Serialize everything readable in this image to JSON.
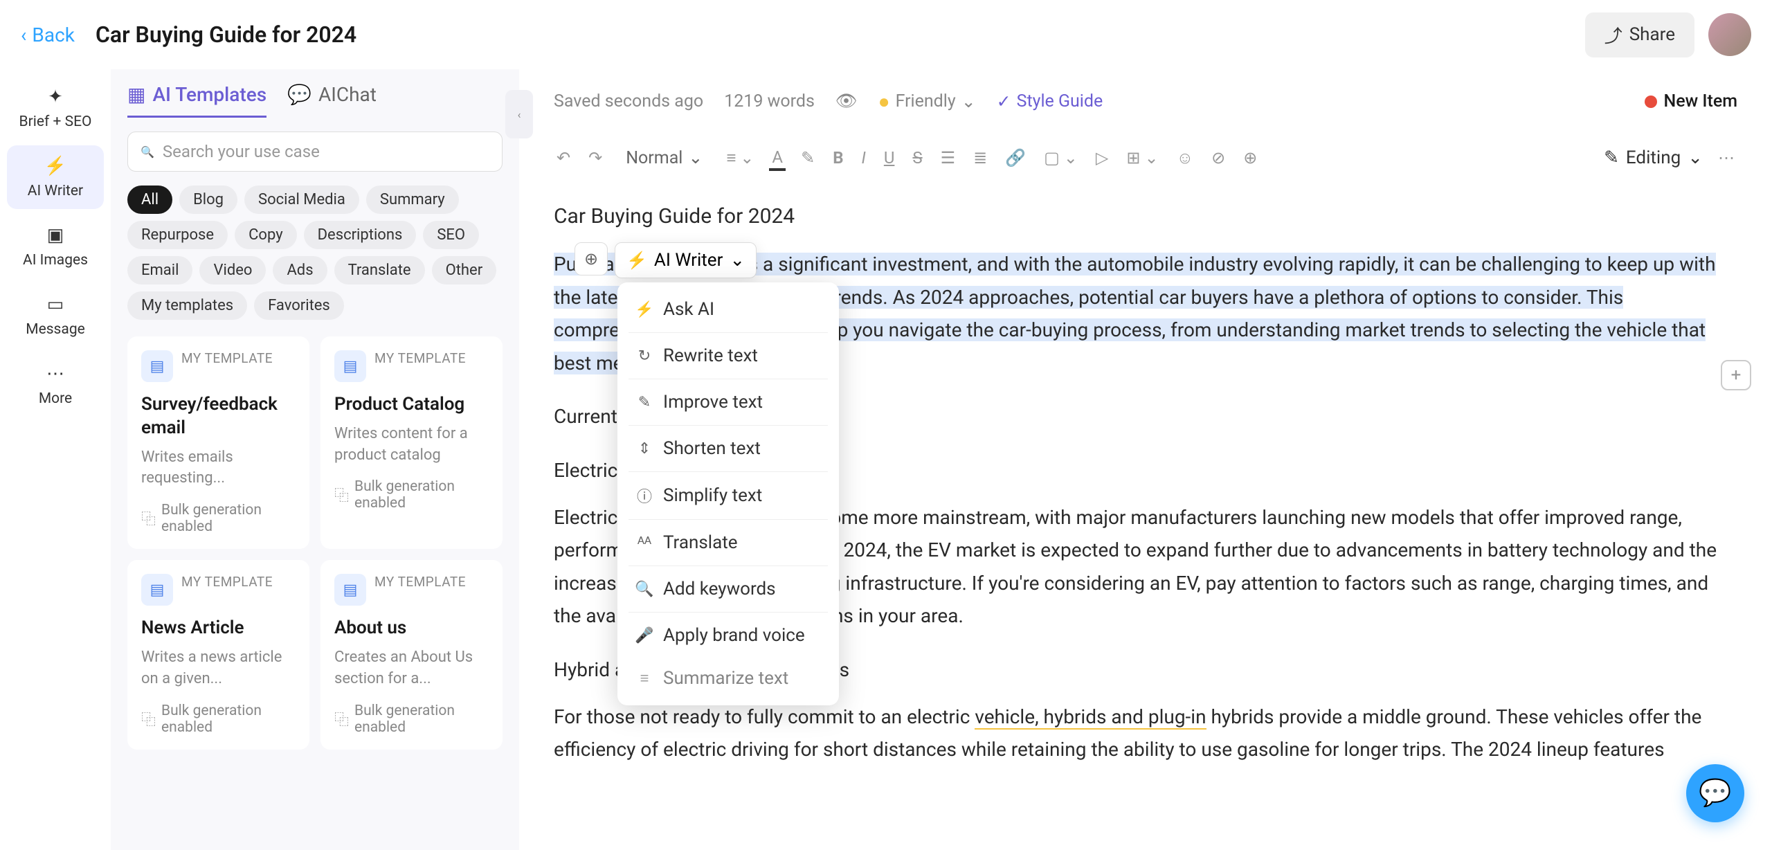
{
  "header": {
    "back_label": "Back",
    "title": "Car Buying Guide for 2024",
    "share_label": "Share"
  },
  "left_nav": {
    "items": [
      {
        "label": "Brief + SEO",
        "icon": "✦"
      },
      {
        "label": "AI Writer",
        "icon": "⚡"
      },
      {
        "label": "AI Images",
        "icon": "🖼"
      },
      {
        "label": "Message",
        "icon": "💬"
      },
      {
        "label": "More",
        "icon": "⋯"
      }
    ],
    "active_index": 1
  },
  "sidebar": {
    "tabs": [
      "AI Templates",
      "AIChat"
    ],
    "active_tab": 0,
    "search_placeholder": "Search your use case",
    "chips": [
      "All",
      "Blog",
      "Social Media",
      "Summary",
      "Repurpose",
      "Copy",
      "Descriptions",
      "SEO",
      "Email",
      "Video",
      "Ads",
      "Translate",
      "Other",
      "My templates",
      "Favorites"
    ],
    "active_chip": 0,
    "cards": [
      {
        "tag": "MY TEMPLATE",
        "title": "Survey/feedback email",
        "desc": "Writes emails requesting...",
        "footer": "Bulk generation enabled"
      },
      {
        "tag": "MY TEMPLATE",
        "title": "Product Catalog",
        "desc": "Writes content for a product catalog",
        "footer": "Bulk generation enabled"
      },
      {
        "tag": "MY TEMPLATE",
        "title": "News Article",
        "desc": "Writes a news article on a given...",
        "footer": "Bulk generation enabled"
      },
      {
        "tag": "MY TEMPLATE",
        "title": "About us",
        "desc": "Creates an About Us section for a...",
        "footer": "Bulk generation enabled"
      }
    ]
  },
  "editor_top": {
    "saved": "Saved seconds ago",
    "word_count": "1219 words",
    "tone": "Friendly",
    "style_guide": "Style Guide",
    "new_item": "New Item"
  },
  "toolbar": {
    "format": "Normal",
    "mode": "Editing"
  },
  "document": {
    "title": "Car Buying Guide for 2024",
    "p1": "Purchasing a new car is a significant investment, and with the automobile industry evolving rapidly, it can be challenging to keep up with the latest models, features, and trends. As 2024 approaches, potential car buyers have a plethora of options to consider. This comprehensive guide aims to help you navigate the car-buying process, from understanding market trends to selecting the vehicle that best meets your needs.",
    "h2a": "Current Market Trends",
    "h3a": "Electric Vehicles (EVs)",
    "p2a": "Electric vehicles continue to become more mainstream, with major manufacturers launching new models that offer improved range, performance, and affordability.",
    "p2b": " In 2024, the EV market is expected to expand further due to advancements in battery technology and the increasing availability of charging infrastructure. If you're considering an EV, pay attention to factors such as range, charging times, and the availability of charging stations in your area.",
    "h3b": "Hybrid and Plug-in Hybrid Vehicles",
    "p3a": "For those not ready to fully commit to an electric ",
    "p3b": "vehicle, hybrids and plug-in",
    "p3c": " hybrids provide a middle ground. These vehicles offer the efficiency of electric driving for short distances while retaining the ability to use gasoline for longer trips. The 2024 lineup features"
  },
  "ai_writer": {
    "label": "AI Writer"
  },
  "ai_menu": {
    "items": [
      {
        "icon": "⚡",
        "label": "Ask AI"
      },
      {
        "icon": "↻",
        "label": "Rewrite text"
      },
      {
        "icon": "✎",
        "label": "Improve text"
      },
      {
        "icon": "⇕",
        "label": "Shorten text"
      },
      {
        "icon": "ⓘ",
        "label": "Simplify text"
      },
      {
        "icon": "🌐",
        "label": "Translate"
      },
      {
        "icon": "🔍",
        "label": "Add keywords"
      },
      {
        "icon": "🎤",
        "label": "Apply brand voice"
      },
      {
        "icon": "≡",
        "label": "Summarize text"
      }
    ]
  }
}
